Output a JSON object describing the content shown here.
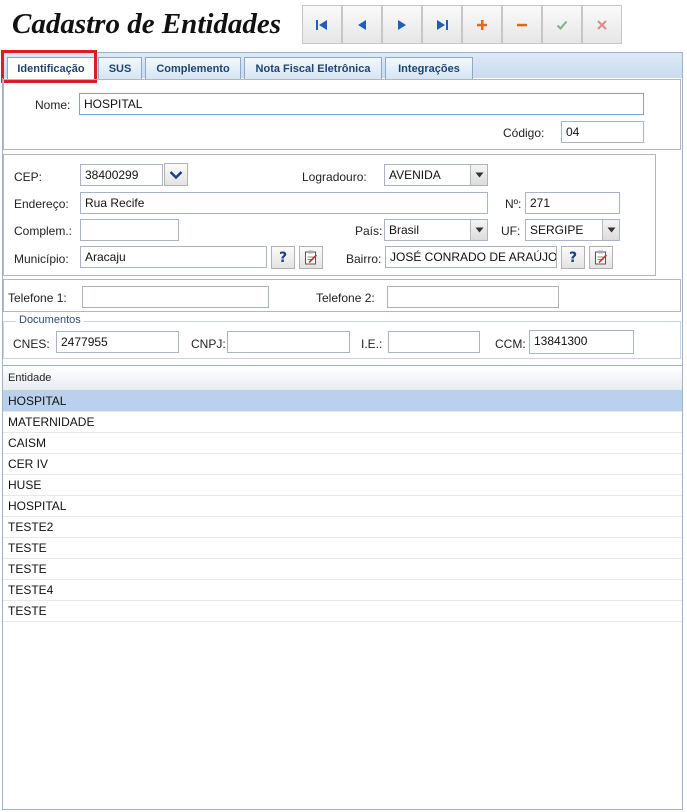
{
  "window": {
    "title": "Cadastro de Entidades"
  },
  "toolbar": {
    "buttons": [
      {
        "name": "first-record-button",
        "icon": "first-icon",
        "color": "#1f5fb5"
      },
      {
        "name": "prev-record-button",
        "icon": "prev-icon",
        "color": "#1f5fb5"
      },
      {
        "name": "next-record-button",
        "icon": "next-icon",
        "color": "#1f5fb5"
      },
      {
        "name": "last-record-button",
        "icon": "last-icon",
        "color": "#1f5fb5"
      },
      {
        "name": "add-record-button",
        "icon": "plus-icon",
        "color": "#e2661b"
      },
      {
        "name": "delete-record-button",
        "icon": "minus-icon",
        "color": "#e2661b"
      },
      {
        "name": "confirm-button",
        "icon": "check-icon",
        "color": "#7fb47f"
      },
      {
        "name": "cancel-button",
        "icon": "x-icon",
        "color": "#e08a8a"
      }
    ]
  },
  "tabs": [
    {
      "label": "Identificação",
      "active": true
    },
    {
      "label": "SUS",
      "active": false
    },
    {
      "label": "Complemento",
      "active": false
    },
    {
      "label": "Nota Fiscal Eletrônica",
      "active": false
    },
    {
      "label": "Integrações",
      "active": false
    }
  ],
  "identity": {
    "nome_label": "Nome:",
    "nome_value": "HOSPITAL",
    "codigo_label": "Código:",
    "codigo_value": "04"
  },
  "address": {
    "cep_label": "CEP:",
    "cep_value": "38400299",
    "logradouro_label": "Logradouro:",
    "logradouro_value": "AVENIDA",
    "endereco_label": "Endereço:",
    "endereco_value": "Rua Recife",
    "numero_label": "Nº:",
    "numero_value": "271",
    "complemento_label": "Complem.:",
    "complemento_value": "",
    "pais_label": "País:",
    "pais_value": "Brasil",
    "uf_label": "UF:",
    "uf_value": "SERGIPE",
    "municipio_label": "Município:",
    "municipio_value": "Aracaju",
    "bairro_label": "Bairro:",
    "bairro_value": "JOSÉ CONRADO DE ARAÚJO",
    "help_symbol": "?"
  },
  "phones": {
    "telefone1_label": "Telefone 1:",
    "telefone1_value": "",
    "telefone2_label": "Telefone 2:",
    "telefone2_value": ""
  },
  "documents": {
    "legend": "Documentos",
    "cnes_label": "CNES:",
    "cnes_value": "2477955",
    "cnpj_label": "CNPJ:",
    "cnpj_value": "",
    "ie_label": "I.E.:",
    "ie_value": "",
    "ccm_label": "CCM:",
    "ccm_value": "13841300"
  },
  "grid": {
    "header": "Entidade",
    "rows": [
      "HOSPITAL",
      "MATERNIDADE",
      "CAISM",
      "CER IV",
      "HUSE",
      "HOSPITAL",
      "TESTE2",
      "TESTE",
      "TESTE",
      "TESTE4",
      "TESTE"
    ],
    "selected_index": 0
  },
  "colors": {
    "tab_text": "#1e4470",
    "highlight": "#e01b24",
    "selected_row": "#b9d1ec"
  }
}
